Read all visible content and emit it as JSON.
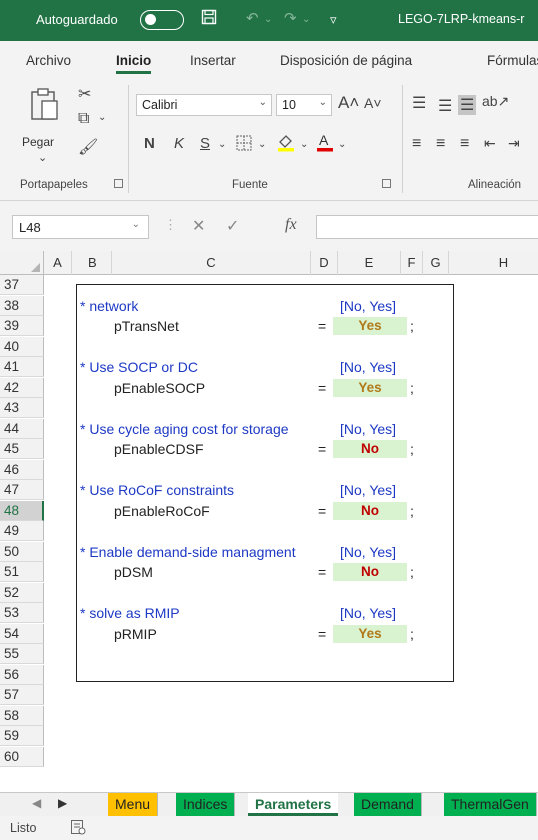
{
  "titlebar": {
    "autosave_label": "Autoguardado",
    "document_name": "LEGO-7LRP-kmeans-r"
  },
  "tabs": [
    "Archivo",
    "Inicio",
    "Insertar",
    "Disposición de página",
    "Fórmulas"
  ],
  "active_tab": "Inicio",
  "ribbon": {
    "paste_label": "Pegar",
    "font_name": "Calibri",
    "font_size": "10",
    "bold": "N",
    "italic": "K",
    "underline": "S",
    "groups": {
      "clipboard": "Portapapeles",
      "font": "Fuente",
      "alignment": "Alineación"
    }
  },
  "formula_bar": {
    "name_box": "L48",
    "fx": "fx",
    "formula": ""
  },
  "grid": {
    "columns": [
      "A",
      "B",
      "C",
      "D",
      "E",
      "F",
      "G",
      "H"
    ],
    "rows": [
      "37",
      "38",
      "39",
      "40",
      "41",
      "42",
      "43",
      "44",
      "45",
      "46",
      "47",
      "48",
      "49",
      "50",
      "51",
      "52",
      "53",
      "54",
      "55",
      "56",
      "57",
      "58",
      "59",
      "60"
    ],
    "selected_row": "48",
    "options_header": "[No, Yes]",
    "equals": "=",
    "semicolon": ";",
    "params": [
      {
        "comment": "* network",
        "name": "pTransNet",
        "value": "Yes"
      },
      {
        "comment": "* Use SOCP or DC",
        "name": "pEnableSOCP",
        "value": "Yes"
      },
      {
        "comment": "* Use cycle aging cost for storage",
        "name": "pEnableCDSF",
        "value": "No"
      },
      {
        "comment": "* Use RoCoF constraints",
        "name": "pEnableRoCoF",
        "value": "No"
      },
      {
        "comment": "* Enable demand-side managment",
        "name": "pDSM",
        "value": "No"
      },
      {
        "comment": "* solve as RMIP",
        "name": "pRMIP",
        "value": "Yes"
      }
    ]
  },
  "sheets": [
    {
      "name": "Menu",
      "color": "#ffc000"
    },
    {
      "name": "Indices",
      "color": "#00b050"
    },
    {
      "name": "Parameters",
      "color": "#ffffff"
    },
    {
      "name": "Demand",
      "color": "#00b050"
    },
    {
      "name": "ThermalGen",
      "color": "#00b050"
    }
  ],
  "active_sheet": "Parameters",
  "status": {
    "ready": "Listo"
  },
  "colors": {
    "excel_green": "#217346",
    "comment_blue": "#1d39c4",
    "value_bg": "#d9f2d0",
    "yes_text": "#b07a1a",
    "no_text": "#c00000"
  }
}
